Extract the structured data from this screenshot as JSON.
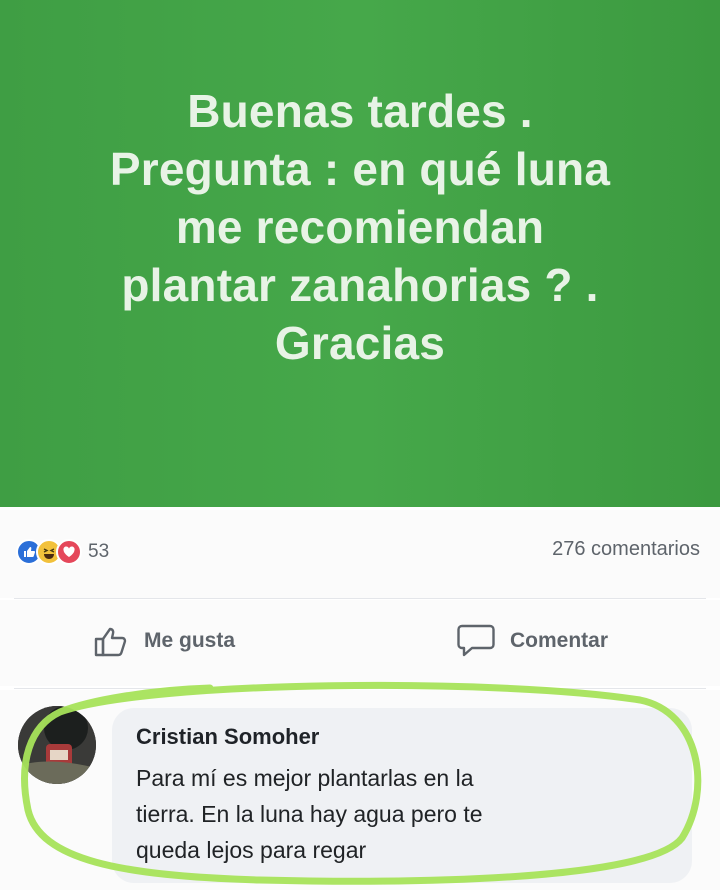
{
  "post": {
    "lines": [
      "Buenas tardes .",
      "Pregunta : en qué luna",
      "me recomiendan",
      "plantar zanahorias ? .",
      "Gracias"
    ],
    "background_color": "#43a447",
    "text_color": "#e8f3e6"
  },
  "stats": {
    "reaction_icons": [
      "like-icon",
      "haha-icon",
      "love-icon"
    ],
    "reaction_count": "53",
    "comments_label": "276 comentarios"
  },
  "actions": {
    "like_label": "Me gusta",
    "comment_label": "Comentar"
  },
  "comment": {
    "author": "Cristian Somoher",
    "lines": [
      "Para mí es mejor plantarlas en la",
      "tierra. En la luna hay agua pero te",
      "queda lejos para regar"
    ],
    "highlight_color": "#a6e35a"
  }
}
